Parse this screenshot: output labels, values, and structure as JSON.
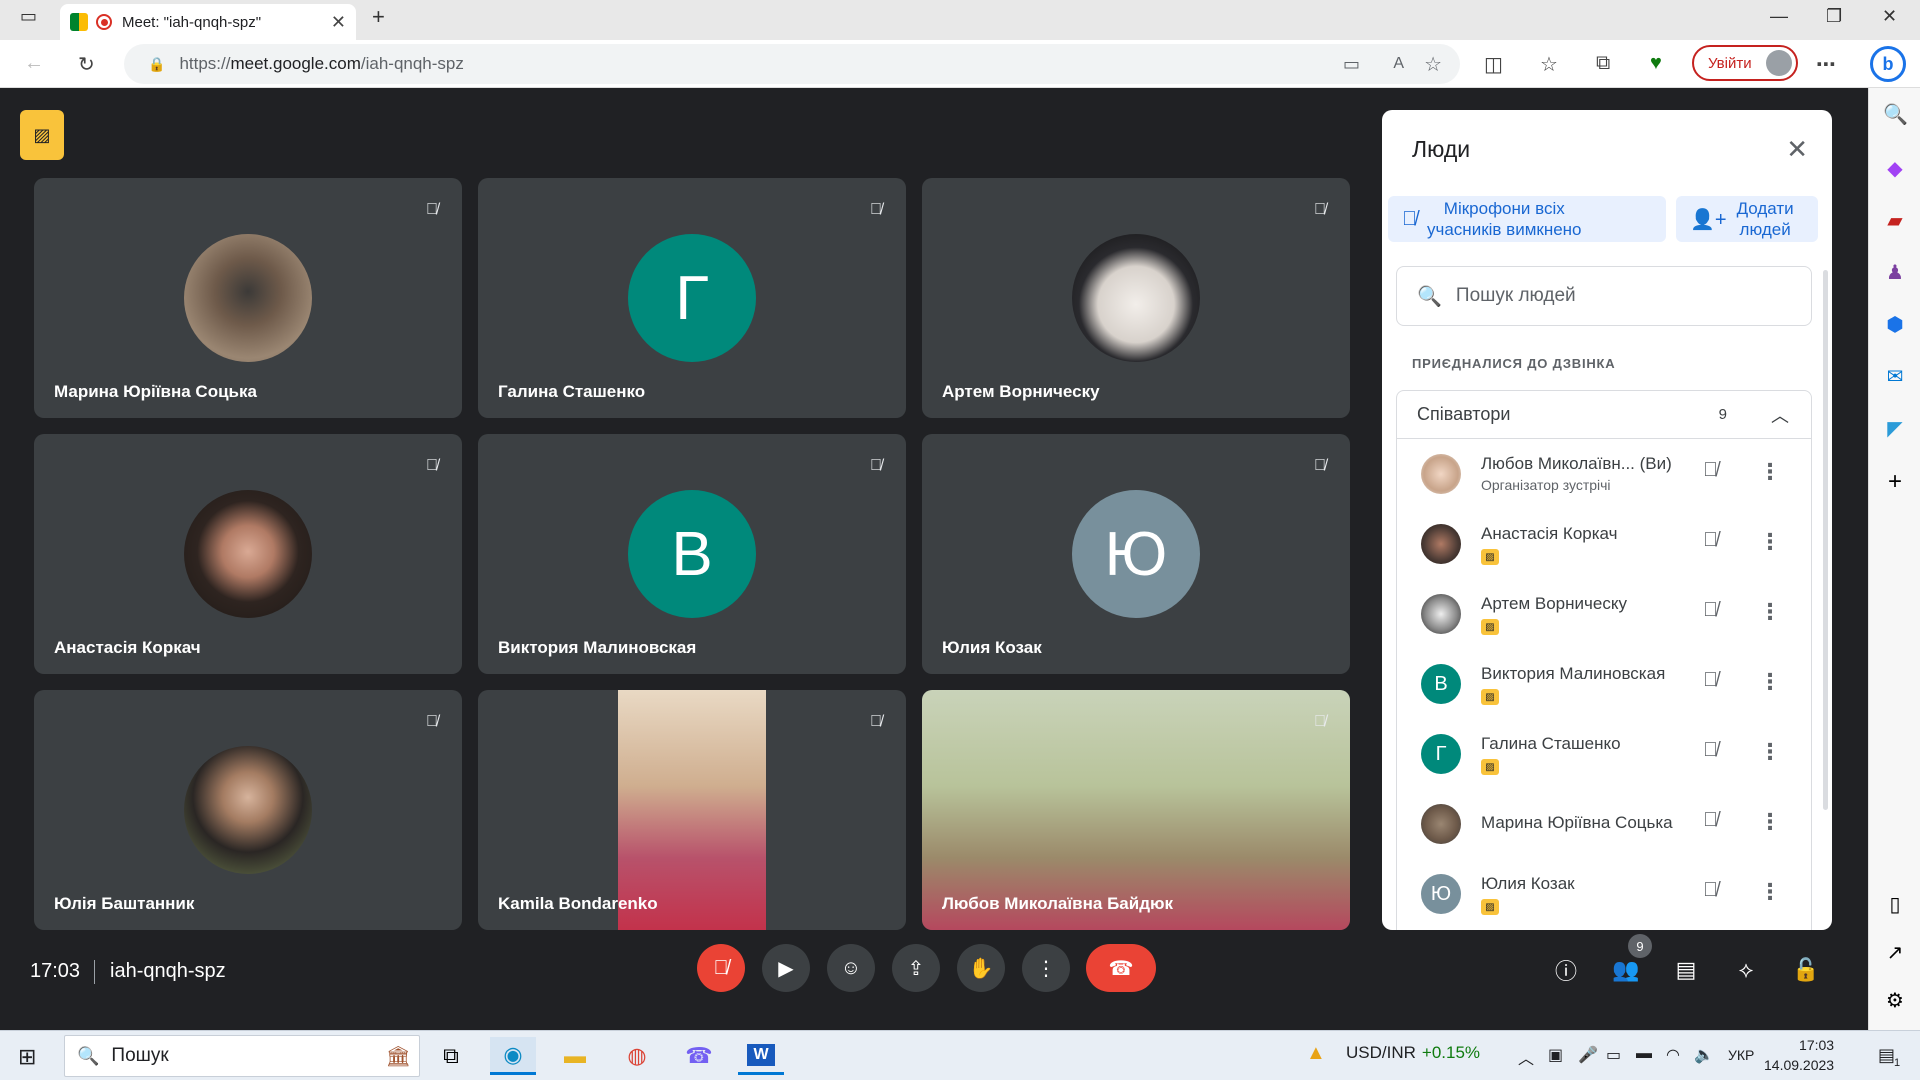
{
  "browser": {
    "tab_title": "Meet: \"iah-qnqh-spz\"",
    "url_prefix": "https://",
    "url_host": "meet.google.com",
    "url_path": "/iah-qnqh-spz",
    "login_label": "Увійти"
  },
  "tiles": [
    {
      "name": "Марина Юріївна Соцька",
      "type": "photo",
      "color": "#7a6a5a"
    },
    {
      "name": "Галина Сташенко",
      "type": "letter",
      "letter": "Г",
      "color": "#00897b"
    },
    {
      "name": "Артем Ворническу",
      "type": "photo",
      "color": "#dcdcdc"
    },
    {
      "name": "Анастасія Коркач",
      "type": "photo",
      "color": "#4a3a34"
    },
    {
      "name": "Виктория Малиновская",
      "type": "letter",
      "letter": "В",
      "color": "#00897b"
    },
    {
      "name": "Юлия Козак",
      "type": "letter",
      "letter": "Ю",
      "color": "#78909c"
    },
    {
      "name": "Юлія Баштанник",
      "type": "photo",
      "color": "#5a6a4a"
    },
    {
      "name": "Kamila Bondarenko",
      "type": "video"
    },
    {
      "name": "Любов Миколаївна Байдюк",
      "type": "video"
    }
  ],
  "bottom": {
    "time": "17:03",
    "meeting_code": "iah-qnqh-spz",
    "participants_badge": "9"
  },
  "panel": {
    "title": "Люди",
    "mute_all_label_1": "Мікрофони всіх",
    "mute_all_label_2": "учасників вимкнено",
    "add_label_1": "Додати",
    "add_label_2": "людей",
    "search_placeholder": "Пошук людей",
    "joined_heading": "ПРИЄДНАЛИСЯ ДО ДЗВІНКА",
    "group_label": "Співавтори",
    "group_count": "9",
    "people": [
      {
        "name": "Любов Миколаївн...",
        "suffix": "(Ви)",
        "sub": "Організатор зустрічі",
        "type": "photo",
        "color": "#c8a48a"
      },
      {
        "name": "Анастасія Коркач",
        "tag": true,
        "type": "photo",
        "color": "#4a3a34"
      },
      {
        "name": "Артем Ворническу",
        "tag": true,
        "type": "photo",
        "color": "#8a8a8a"
      },
      {
        "name": "Виктория Малиновская",
        "tag": true,
        "type": "letter",
        "letter": "В",
        "color": "#00897b"
      },
      {
        "name": "Галина Сташенко",
        "tag": true,
        "type": "letter",
        "letter": "Г",
        "color": "#00897b"
      },
      {
        "name": "Марина Юріївна Соцька",
        "type": "photo",
        "color": "#7a6a5a"
      },
      {
        "name": "Юлия Козак",
        "tag": true,
        "type": "letter",
        "letter": "Ю",
        "color": "#78909c"
      }
    ]
  },
  "taskbar": {
    "search_label": "Пошук",
    "ticker_label": "USD/INR",
    "ticker_value": "+0.15%",
    "lang": "УКР",
    "time": "17:03",
    "date": "14.09.2023",
    "notif_count": "1"
  }
}
